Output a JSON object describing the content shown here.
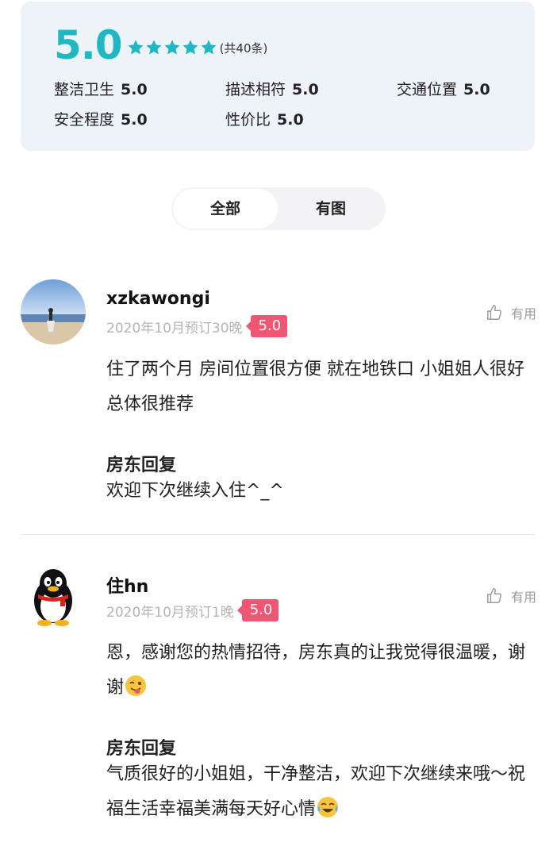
{
  "summary": {
    "score": "5.0",
    "count_label": "(共40条)",
    "star_color": "#1fb8c2",
    "sub_scores": [
      {
        "label": "整洁卫生",
        "value": "5.0"
      },
      {
        "label": "描述相符",
        "value": "5.0"
      },
      {
        "label": "交通位置",
        "value": "5.0"
      },
      {
        "label": "安全程度",
        "value": "5.0"
      },
      {
        "label": "性价比",
        "value": "5.0"
      }
    ]
  },
  "filter": {
    "tabs": [
      {
        "label": "全部",
        "active": true
      },
      {
        "label": "有图",
        "active": false
      }
    ]
  },
  "reviews": [
    {
      "username": "xzkawongi",
      "date": "2020年10月预订30晚",
      "rating": "5.0",
      "useful_label": "有用",
      "content": "住了两个月 房间位置很方便 就在地铁口 小姐姐人很好 总体很推荐",
      "reply_title": "房东回复",
      "reply_text": "欢迎下次继续入住^_^"
    },
    {
      "username": "住hn",
      "date": "2020年10月预订1晚",
      "rating": "5.0",
      "useful_label": "有用",
      "content": "恩，感谢您的热情招待，房东真的让我觉得很温暖，谢谢",
      "reply_title": "房东回复",
      "reply_text": "气质很好的小姐姐，干净整洁，欢迎下次继续来哦～祝福生活幸福美满每天好心情"
    }
  ],
  "colors": {
    "accent": "#1fb8c2",
    "badge": "#ef5673",
    "summary_bg": "#eef3fa"
  }
}
